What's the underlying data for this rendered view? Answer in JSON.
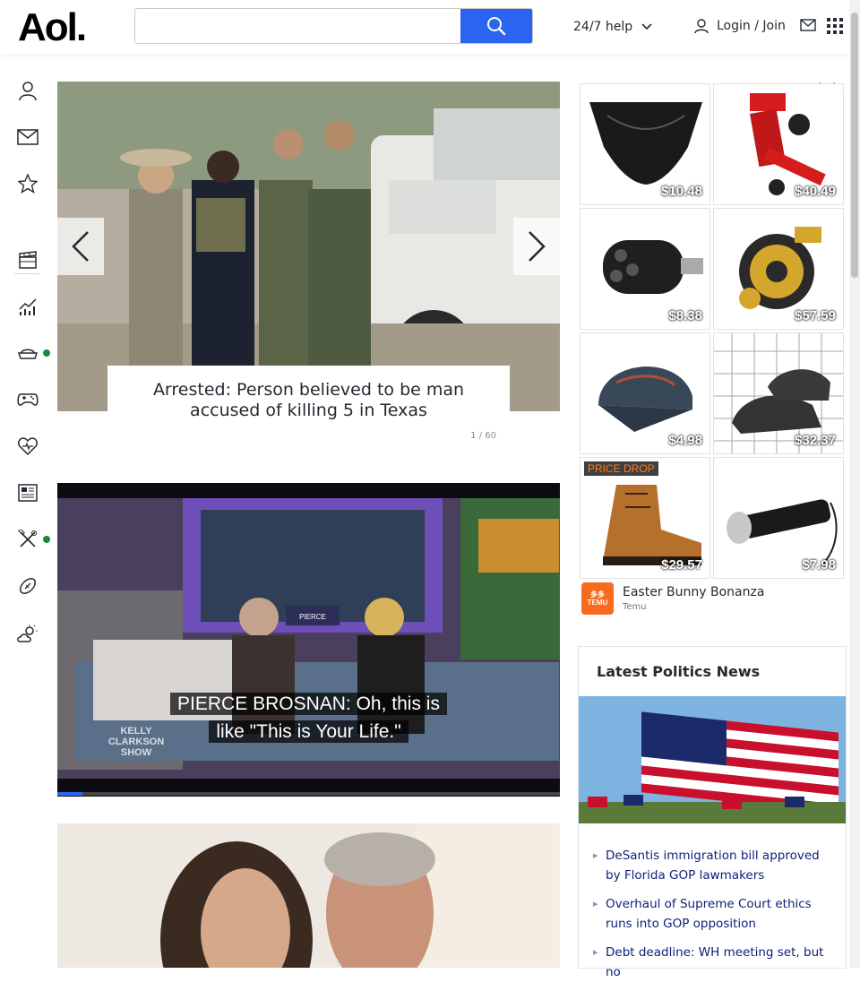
{
  "header": {
    "logo": "Aol.",
    "search": {
      "value": "",
      "placeholder": ""
    },
    "help_label": "24/7 help",
    "login_label": "Login / Join"
  },
  "sidebar": {
    "items": [
      {
        "name": "profile",
        "icon": "user-icon"
      },
      {
        "name": "mail",
        "icon": "mail-icon"
      },
      {
        "name": "favorites",
        "icon": "star-icon"
      },
      {
        "name": "entertainment",
        "icon": "clapperboard-icon"
      },
      {
        "name": "finance",
        "icon": "chart-icon"
      },
      {
        "name": "food",
        "icon": "food-icon",
        "dot": true
      },
      {
        "name": "games",
        "icon": "gamepad-icon"
      },
      {
        "name": "health",
        "icon": "heart-icon"
      },
      {
        "name": "news",
        "icon": "newspaper-icon"
      },
      {
        "name": "lifestyle",
        "icon": "tools-icon",
        "dot": true
      },
      {
        "name": "sports",
        "icon": "football-icon"
      },
      {
        "name": "weather",
        "icon": "weather-icon"
      }
    ],
    "dot_color": "#188a3c"
  },
  "slideshow": {
    "caption": "Arrested: Person believed to be man accused of killing 5 in Texas",
    "counter": "1 / 60",
    "current": 1,
    "total": 60
  },
  "video": {
    "subtitle_line1": "PIERCE BROSNAN: Oh, this is",
    "subtitle_line2": "like \"This is Your Life.\"",
    "set_sign": "PIERCE",
    "show_logo_line1": "KELLY",
    "show_logo_line2": "CLARKSON",
    "show_logo_line3": "SHOW",
    "progress_percent": 5
  },
  "ads": {
    "tiles": [
      {
        "price": "$10.48",
        "icon": "underwear-image"
      },
      {
        "price": "$40.49",
        "icon": "tool-clamp-image"
      },
      {
        "price": "$8.38",
        "icon": "nozzle-image"
      },
      {
        "price": "$57.59",
        "icon": "fishing-reel-image"
      },
      {
        "price": "$4.98",
        "icon": "cap-image"
      },
      {
        "price": "$32.37",
        "icon": "shoes-image"
      },
      {
        "price": "$29.57",
        "icon": "boot-image",
        "badge": "PRICE DROP"
      },
      {
        "price": "$7.98",
        "icon": "flashlight-image"
      }
    ],
    "sponsor_title": "Easter Bunny Bonanza",
    "sponsor_brand": "Temu",
    "sponsor_logo_line1": "多多",
    "sponsor_logo_line2": "TEMU"
  },
  "politics": {
    "title": "Latest Politics News",
    "headlines": [
      "DeSantis immigration bill approved by Florida GOP lawmakers",
      "Overhaul of Supreme Court ethics runs into GOP opposition",
      "Debt deadline: WH meeting set, but no"
    ]
  },
  "colors": {
    "accent": "#2b64f2",
    "link": "#0f1d7a"
  }
}
